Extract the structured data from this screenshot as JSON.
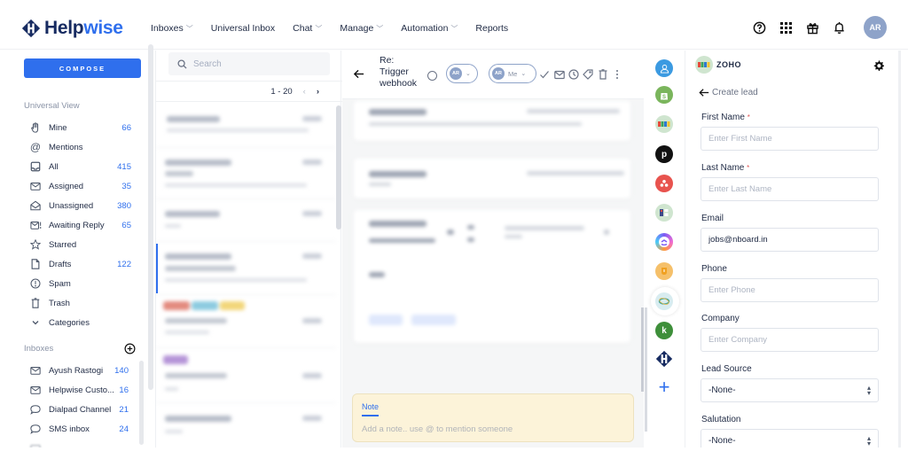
{
  "brand": {
    "name_part1": "Help",
    "name_part2": "wise",
    "primary_color": "#2f6fed",
    "dark_color": "#172b61"
  },
  "nav": {
    "items": [
      {
        "label": "Inboxes",
        "dropdown": true
      },
      {
        "label": "Universal Inbox",
        "dropdown": false
      },
      {
        "label": "Chat",
        "dropdown": true
      },
      {
        "label": "Manage",
        "dropdown": true
      },
      {
        "label": "Automation",
        "dropdown": true
      },
      {
        "label": "Reports",
        "dropdown": false
      }
    ],
    "chevron": "⌄",
    "icons": [
      "help-icon",
      "apps-grid-icon",
      "gift-icon",
      "bell-icon"
    ],
    "avatar_initials": "AR"
  },
  "sidebar": {
    "compose_label": "COMPOSE",
    "universal_title": "Universal View",
    "views": [
      {
        "label": "Mine",
        "count": "66",
        "icon": "hand-icon"
      },
      {
        "label": "Mentions",
        "count": "",
        "icon": "at-icon"
      },
      {
        "label": "All",
        "count": "415",
        "icon": "inbox-tray-icon"
      },
      {
        "label": "Assigned",
        "count": "35",
        "icon": "envelope-icon"
      },
      {
        "label": "Unassigned",
        "count": "380",
        "icon": "open-envelope-icon"
      },
      {
        "label": "Awaiting Reply",
        "count": "65",
        "icon": "envelope-alert-icon"
      },
      {
        "label": "Starred",
        "count": "",
        "icon": "star-icon"
      },
      {
        "label": "Drafts",
        "count": "122",
        "icon": "file-icon"
      },
      {
        "label": "Spam",
        "count": "",
        "icon": "alert-circle-icon"
      },
      {
        "label": "Trash",
        "count": "",
        "icon": "trash-icon"
      },
      {
        "label": "Categories",
        "count": "",
        "icon": "chevron-down-icon"
      }
    ],
    "inboxes_title": "Inboxes",
    "inboxes": [
      {
        "label": "Ayush Rastogi",
        "count": "140",
        "icon": "envelope-icon"
      },
      {
        "label": "Helpwise Custo...",
        "count": "16",
        "icon": "envelope-icon"
      },
      {
        "label": "Dialpad Channel",
        "count": "21",
        "icon": "chat-bubble-icon"
      },
      {
        "label": "SMS inbox",
        "count": "24",
        "icon": "chat-bubble-icon"
      }
    ]
  },
  "conversations": {
    "search_placeholder": "Search",
    "pagination": "1 - 20",
    "prev": "‹",
    "next": "›"
  },
  "message": {
    "subject_line1": "Re:",
    "subject_line2": "Trigger",
    "subject_line3": "webhook",
    "assignee_initials": "AR",
    "me_initials": "AR",
    "me_label": "Me",
    "note_tab": "Note",
    "note_placeholder": "Add a note.. use @ to mention someone"
  },
  "rail": {
    "apps": [
      {
        "name": "contacts",
        "color": "#3b9ae1"
      },
      {
        "name": "shopify",
        "color": "#7ab55c"
      },
      {
        "name": "zoho",
        "color": "#cfe5cf"
      },
      {
        "name": "pipedrive",
        "color": "#111111"
      },
      {
        "name": "asana",
        "color": "#e8534e"
      },
      {
        "name": "app-grid",
        "color": "#cfe5cf"
      },
      {
        "name": "clickup",
        "color": "#7b5cf5"
      },
      {
        "name": "app-orange",
        "color": "#f5c06a"
      },
      {
        "name": "app-ring",
        "color": "#e6f0f4"
      },
      {
        "name": "keap",
        "color": "#3e8f3a"
      },
      {
        "name": "helpwise",
        "color": "#172b61"
      }
    ],
    "add_label": "+"
  },
  "zoho_panel": {
    "title": "ZOHO",
    "back_label": "Create lead",
    "fields": [
      {
        "label": "First Name",
        "required": "*",
        "placeholder": "Enter First Name",
        "value": ""
      },
      {
        "label": "Last Name",
        "required": "*",
        "placeholder": "Enter Last Name",
        "value": ""
      },
      {
        "label": "Email",
        "required": "",
        "placeholder": "",
        "value": "jobs@nboard.in"
      },
      {
        "label": "Phone",
        "required": "",
        "placeholder": "Enter Phone",
        "value": ""
      },
      {
        "label": "Company",
        "required": "",
        "placeholder": "Enter Company",
        "value": ""
      }
    ],
    "selects": [
      {
        "label": "Lead Source",
        "value": "-None-"
      },
      {
        "label": "Salutation",
        "value": "-None-"
      }
    ]
  }
}
